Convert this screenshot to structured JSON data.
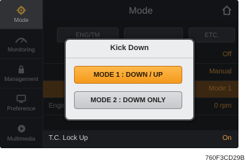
{
  "sidebar": {
    "items": [
      {
        "label": "Mode",
        "icon": "gear-icon",
        "active": true
      },
      {
        "label": "Monitoring",
        "icon": "monitoring-icon",
        "active": false
      },
      {
        "label": "Management",
        "icon": "lock-icon",
        "active": false
      },
      {
        "label": "Preference",
        "icon": "monitor-icon",
        "active": false
      },
      {
        "label": "Multimedia",
        "icon": "play-icon",
        "active": false
      }
    ]
  },
  "header": {
    "title": "Mode",
    "home_icon": "home-icon"
  },
  "tabs": [
    "ENG/TM",
    "",
    "ETC."
  ],
  "rows": [
    {
      "label": "",
      "value": "Off"
    },
    {
      "label": "",
      "value": "Manual"
    },
    {
      "label": "",
      "value": "Mode 1"
    },
    {
      "label": "Engine Speed",
      "value": "0 rpm"
    },
    {
      "label": "T.C. Lock Up",
      "value": "On"
    }
  ],
  "dialog": {
    "title": "Kick Down",
    "options": [
      {
        "label": "MODE 1 : DOWN / UP",
        "selected": true
      },
      {
        "label": "MODE 2 : DOWM ONLY",
        "selected": false
      }
    ]
  },
  "caption": "760F3CD29B",
  "colors": {
    "accent": "#f39a1c",
    "background": "#1a1c20",
    "dialog_bg": "#ecedef"
  }
}
